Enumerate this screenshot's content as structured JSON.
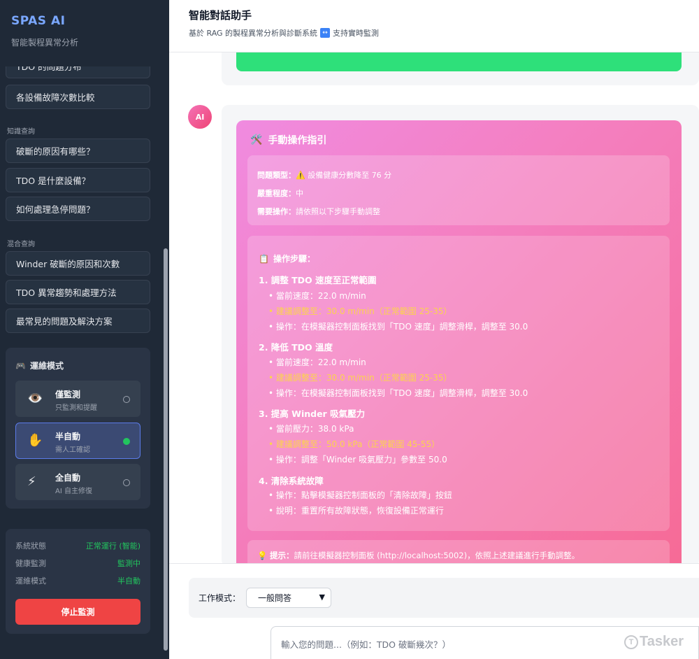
{
  "sidebar": {
    "brand_title": "SPAS AI",
    "brand_subtitle": "智能製程異常分析",
    "top_cut_item": "TDO 的問題分布",
    "items_misc": [
      "各設備故障次數比較"
    ],
    "sections": [
      {
        "label": "知識查詢",
        "items": [
          "破斷的原因有哪些？",
          "TDO 是什麼設備？",
          "如何處理急停問題？"
        ]
      },
      {
        "label": "混合查詢",
        "items": [
          "Winder 破斷的原因和次數",
          "TDO 異常趨勢和處理方法",
          "最常見的問題及解決方案"
        ]
      }
    ],
    "ops_mode": {
      "heading": "運維模式",
      "heading_icon": "🎮",
      "options": [
        {
          "name": "僅監測",
          "desc": "只監測和提醒",
          "icon": "👁️",
          "selected": false
        },
        {
          "name": "半自動",
          "desc": "需人工確認",
          "icon": "✋",
          "selected": true
        },
        {
          "name": "全自動",
          "desc": "AI 自主修復",
          "icon": "⚡",
          "selected": false
        }
      ]
    },
    "status": {
      "rows": [
        {
          "label": "系統狀態",
          "value": "正常運行 (智能)"
        },
        {
          "label": "健康監測",
          "value": "監測中"
        },
        {
          "label": "運維模式",
          "value": "半自動"
        }
      ],
      "stop_button": "停止監測"
    }
  },
  "header": {
    "title": "智能對話助手",
    "subtitle_left": "基於 RAG 的製程異常分析與診斷系統",
    "arrow_glyph": "↔",
    "subtitle_right": "支持實時監測"
  },
  "chat": {
    "avatar_label": "AI",
    "card": {
      "title_icon": "🛠️",
      "title": "手動操作指引",
      "info": [
        {
          "label": "問題類型：",
          "value": "⚠️ 設備健康分數降至 76 分"
        },
        {
          "label": "嚴重程度：",
          "value": "中"
        },
        {
          "label": "需要操作：",
          "value": "請依照以下步驟手動調整"
        }
      ],
      "steps_icon": "📋",
      "steps_heading": "操作步驟：",
      "steps": [
        {
          "title": "1. 調整 TDO 速度至正常範圍",
          "items": [
            {
              "text": "• 當前速度：22.0 m/min",
              "highlight": false
            },
            {
              "text": "• 建議調整至：30.0 m/min（正常範圍 25-35）",
              "highlight": true
            },
            {
              "text": "• 操作：在模擬器控制面板找到「TDO 速度」調整滑桿，調整至 30.0",
              "highlight": false
            }
          ]
        },
        {
          "title": "2. 降低 TDO 溫度",
          "items": [
            {
              "text": "• 當前速度：22.0 m/min",
              "highlight": false
            },
            {
              "text": "• 建議調整至：30.0 m/min（正常範圍 25-35）",
              "highlight": true
            },
            {
              "text": "• 操作：在模擬器控制面板找到「TDO 速度」調整滑桿，調整至 30.0",
              "highlight": false
            }
          ]
        },
        {
          "title": "3. 提高 Winder 吸氣壓力",
          "items": [
            {
              "text": "• 當前壓力：38.0 kPa",
              "highlight": false
            },
            {
              "text": "• 建議調整至：50.0 kPa（正常範圍 45-55）",
              "highlight": true
            },
            {
              "text": "• 操作：調整「Winder 吸氣壓力」參數至 50.0",
              "highlight": false
            }
          ]
        },
        {
          "title": "4. 清除系統故障",
          "items": [
            {
              "text": "• 操作：點擊模擬器控制面板的「清除故障」按鈕",
              "highlight": false
            },
            {
              "text": "• 說明：重置所有故障狀態，恢復設備正常運行",
              "highlight": false
            }
          ]
        }
      ],
      "tip_icon": "💡",
      "tip_label": "提示：",
      "tip_text": "請前往模擬器控制面板 (http://localhost:5002)，依照上述建議進行手動調整。"
    }
  },
  "composer": {
    "mode_label": "工作模式：",
    "mode_value": "一般問答",
    "input_placeholder": "輸入您的問題...（例如：TDO 破斷幾次？）",
    "watermark": "Tasker"
  }
}
